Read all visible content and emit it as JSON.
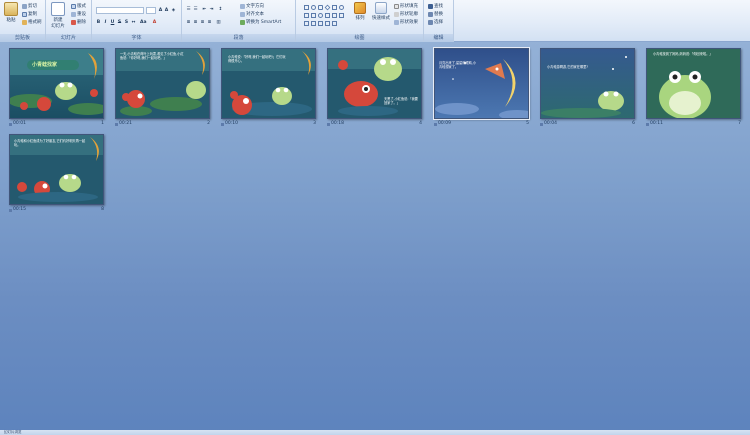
{
  "ribbon": {
    "clipboard": {
      "paste": "粘贴",
      "cut": "剪切",
      "copy": "复制",
      "format_painter": "格式刷",
      "label": "剪贴板"
    },
    "slides": {
      "new_slide": "新建",
      "new_slide_2": "幻灯片",
      "layout": "版式",
      "reset": "重设",
      "delete": "删除",
      "label": "幻灯片"
    },
    "font": {
      "font_name": "",
      "font_size": "",
      "label": "字体"
    },
    "paragraph": {
      "text_direction": "文字方向",
      "align_text": "对齐文本",
      "smartart": "转换为 SmartArt",
      "label": "段落"
    },
    "drawing": {
      "arrange": "排列",
      "quick_styles": "快速样式",
      "shape_fill": "形状填充",
      "shape_outline": "形状轮廓",
      "shape_effects": "形状效果",
      "label": "绘图"
    },
    "editing": {
      "find": "查找",
      "replace": "替换",
      "select": "选择",
      "label": "编辑"
    }
  },
  "slides": [
    {
      "number": "1",
      "time": "00:01",
      "title": "小青蛙找家"
    },
    {
      "number": "2",
      "time": "00:21",
      "text": "一天,小青蛙在荷叶上玩耍,看见了小红鱼,小红鱼说:「你好呀,我们一起玩吧。」"
    },
    {
      "number": "3",
      "time": "00:10",
      "text": "小青蛙说:「好呀,我们一起玩吧!」它们玩得很开心。"
    },
    {
      "number": "4",
      "time": "00:18",
      "text": "天黑了,小红鱼说:「我要回家了。」"
    },
    {
      "number": "5",
      "time": "00:09",
      "text": "月亮出来了,星星眨眼睛,小青蛙想家了。"
    },
    {
      "number": "6",
      "time": "00:04",
      "text": "小青蛙游啊游,它的家在哪里?"
    },
    {
      "number": "7",
      "time": "00:11",
      "text": "小青蛙找到了妈妈,妈妈说:「你回来啦。」"
    },
    {
      "number": "8",
      "time": "00:15",
      "text": "小青蛙和小红鱼成为了好朋友,它们约好明天再一起玩。"
    }
  ],
  "status": {
    "left": "幻灯片浏览",
    "right": ""
  },
  "colors": {
    "ribbon_bg": "#e3ecf8",
    "workspace": "#7fa0cc",
    "slide_border": "#40557a"
  }
}
